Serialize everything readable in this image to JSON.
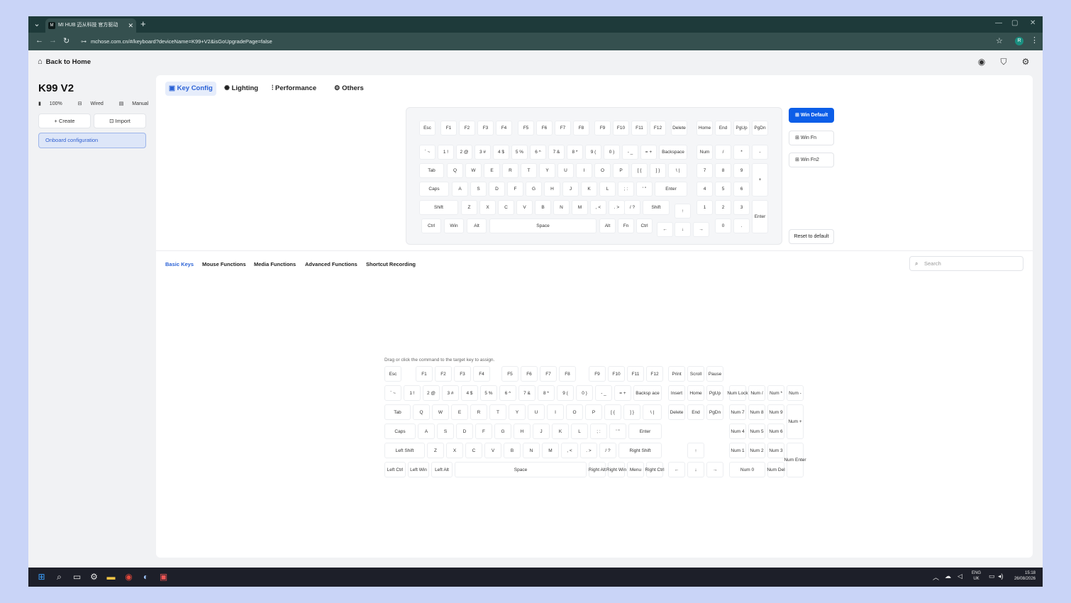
{
  "browser": {
    "tab_title": "MI HUB 迈从科技 官方驱动",
    "url": "mchose.com.cn/#/keyboard?deviceName=K99+V2&isGoUpgradePage=false",
    "profile_initial": "R"
  },
  "header": {
    "back_label": "Back to Home"
  },
  "device": {
    "name": "K99 V2",
    "battery": "100%",
    "connection": "Wired",
    "mode": "Manual",
    "create_label": "Create",
    "import_label": "Import",
    "config_label": "Onboard configuration"
  },
  "topnav": [
    "Key Config",
    "Lighting",
    "Performance",
    "Others"
  ],
  "layers": [
    "Win Default",
    "Win Fn",
    "Win Fn2"
  ],
  "reset_label": "Reset to default",
  "subtabs": [
    "Basic Keys",
    "Mouse Functions",
    "Media Functions",
    "Advanced Functions",
    "Shortcut Recording"
  ],
  "search_placeholder": "Search",
  "hint": "Drag or click the command to the target key to assign.",
  "top_keyboard_rows": [
    [
      "Esc",
      "F1",
      "F2",
      "F3",
      "F4",
      "F5",
      "F6",
      "F7",
      "F8",
      "F9",
      "F10",
      "F11",
      "F12",
      "Delete",
      "Home",
      "End",
      "PgUp",
      "PgDn"
    ],
    [
      "` ~",
      "1 !",
      "2 @",
      "3 #",
      "4 $",
      "5 %",
      "6 ^",
      "7 &",
      "8 *",
      "9 (",
      "0 )",
      "- _",
      "= +",
      "Backspace",
      "Num",
      "/",
      "*",
      "-"
    ],
    [
      "Tab",
      "Q",
      "W",
      "E",
      "R",
      "T",
      "Y",
      "U",
      "I",
      "O",
      "P",
      "[ {",
      "] }",
      "\\ |",
      "7",
      "8",
      "9",
      "+"
    ],
    [
      "Caps",
      "A",
      "S",
      "D",
      "F",
      "G",
      "H",
      "J",
      "K",
      "L",
      "; :",
      "' \"",
      "Enter",
      "4",
      "5",
      "6"
    ],
    [
      "Shift",
      "Z",
      "X",
      "C",
      "V",
      "B",
      "N",
      "M",
      ", <",
      ". >",
      "/ ?",
      "Shift",
      "↑",
      "1",
      "2",
      "3",
      "Enter"
    ],
    [
      "Ctrl",
      "Win",
      "Alt",
      "Space",
      "Alt",
      "Fn",
      "Ctrl",
      "←",
      "↓",
      "→",
      "0",
      "."
    ]
  ],
  "bottom_keyboard_rows": [
    [
      "Esc",
      "F1",
      "F2",
      "F3",
      "F4",
      "F5",
      "F6",
      "F7",
      "F8",
      "F9",
      "F10",
      "F11",
      "F12",
      "Print",
      "Scroll",
      "Pause"
    ],
    [
      "` ~",
      "1 !",
      "2 @",
      "3 #",
      "4 $",
      "5 %",
      "6 ^",
      "7 &",
      "8 *",
      "9 (",
      "0 )",
      "- _",
      "= +",
      "Backsp ace",
      "Insert",
      "Home",
      "PgUp",
      "Num Lock",
      "Num /",
      "Num *",
      "Num -"
    ],
    [
      "Tab",
      "Q",
      "W",
      "E",
      "R",
      "T",
      "Y",
      "U",
      "I",
      "O",
      "P",
      "[ {",
      "] }",
      "\\ |",
      "Delete",
      "End",
      "PgDn",
      "Num 7",
      "Num 8",
      "Num 9",
      "Num +"
    ],
    [
      "Caps",
      "A",
      "S",
      "D",
      "F",
      "G",
      "H",
      "J",
      "K",
      "L",
      "; :",
      "' \"",
      "Enter",
      "Num 4",
      "Num 5",
      "Num 6"
    ],
    [
      "Left Shift",
      "Z",
      "X",
      "C",
      "V",
      "B",
      "N",
      "M",
      ", <",
      ". >",
      "/ ?",
      "Right Shift",
      "↑",
      "Num 1",
      "Num 2",
      "Num 3",
      "Num Enter"
    ],
    [
      "Left Ctrl",
      "Left Win",
      "Left Alt",
      "Space",
      "Right Alt",
      "Right Win",
      "Menu",
      "Right Ctrl",
      "←",
      "↓",
      "→",
      "Num 0",
      "Num Del"
    ]
  ],
  "taskbar": {
    "lang": "ENG",
    "region": "UK",
    "time": "15:18",
    "date": "26/08/2026"
  },
  "colors": {
    "accent": "#0c5ee8",
    "chrome": "#1e3a3a",
    "background": "#c9d4f7"
  }
}
